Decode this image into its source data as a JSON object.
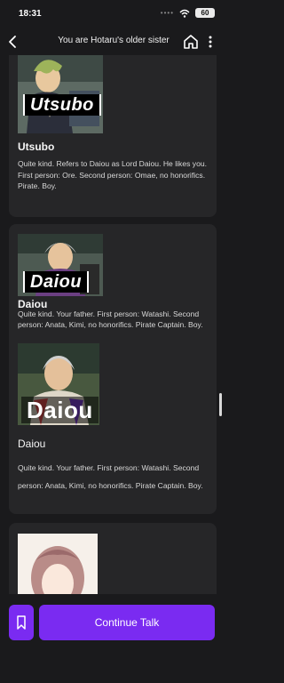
{
  "status_bar": {
    "time": "18:31",
    "battery": "60"
  },
  "header": {
    "title": "You are Hotaru's older sister"
  },
  "characters": [
    {
      "label": "Utsubo",
      "name": "Utsubo",
      "description": "Quite kind. Refers to Daiou as Lord Daiou. He likes you. First person: Ore. Second person: Omae, no honorifics. Pirate. Boy."
    },
    {
      "label": "Daiou",
      "name": "Daiou",
      "description": "Quite kind. Your father. First person: Watashi. Second person: Anata, Kimi, no honorifics. Pirate Captain. Boy.",
      "label2": "Daiou",
      "name2": "Daiou",
      "description2": "Quite kind. Your father. First person: Watashi. Second person: Anata, Kimi, no honorifics. Pirate Captain. Boy."
    }
  ],
  "actions": {
    "continue_label": "Continue Talk"
  },
  "colors": {
    "accent": "#7a2bf1",
    "background": "#1a1a1c",
    "card": "#262628"
  }
}
